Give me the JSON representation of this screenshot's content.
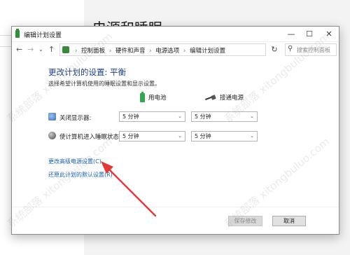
{
  "background": {
    "page_title": "电源和睡眠"
  },
  "window": {
    "title": "编辑计划设置",
    "controls": {
      "minimize": "—",
      "maximize": "☐",
      "close": "✕"
    }
  },
  "addressbar": {
    "back": "←",
    "forward": "→",
    "dropdown": "⌄",
    "up": "↑",
    "breadcrumbs": [
      "控制面板",
      "硬件和声音",
      "电源选项",
      "编辑计划设置"
    ],
    "separator": "›",
    "refresh": "↻",
    "search_placeholder": "搜索控制面板"
  },
  "content": {
    "heading": "更改计划的设置: 平衡",
    "subtext": "选择希望计算机使用的睡眠设置和显示设置。",
    "columns": {
      "battery": "用电池",
      "plugged": "接通电源"
    },
    "rows": [
      {
        "label": "关闭显示器:",
        "battery_value": "5 分钟",
        "plugged_value": "5 分钟"
      },
      {
        "label": "使计算机进入睡眠状态:",
        "battery_value": "5 分钟",
        "plugged_value": "5 分钟"
      }
    ],
    "links": {
      "advanced": "更改高级电源设置(C)",
      "restore": "还原此计划的默认设置(R)"
    }
  },
  "buttons": {
    "save": "保存修改",
    "cancel": "取消"
  },
  "icons": {
    "app": "power-plan-icon",
    "battery": "battery-icon",
    "plug": "power-plug-icon",
    "monitor": "monitor-icon",
    "sleep": "sleep-icon",
    "search": "search-icon"
  },
  "colors": {
    "heading": "#1e3f8a",
    "link": "#1a5fb4",
    "annotation_arrow": "#e53935"
  },
  "watermark": {
    "text": "系统部落 xitongbuluo.com"
  }
}
